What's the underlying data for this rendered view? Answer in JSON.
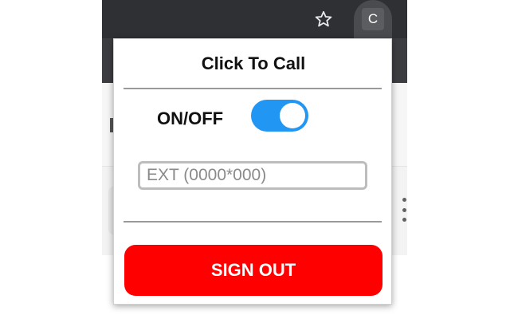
{
  "browser": {
    "toolbar_color": "#2f3033",
    "bookmark_icon": "star-outline-icon",
    "extension_icon_letter": "C"
  },
  "popup": {
    "title": "Click To Call",
    "toggle": {
      "label": "ON/OFF",
      "state": "on",
      "accent_color": "#2196f3"
    },
    "extension_input": {
      "placeholder": "EXT (0000*000)",
      "value": ""
    },
    "sign_out": {
      "label": "SIGN OUT",
      "color": "#ff0000"
    }
  }
}
